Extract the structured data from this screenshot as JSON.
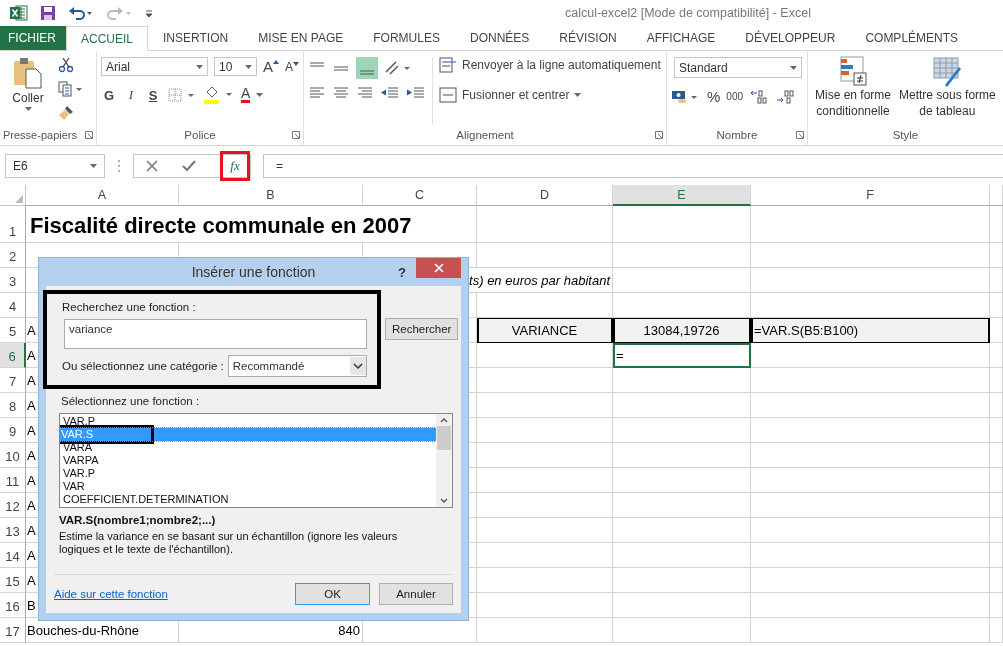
{
  "window": {
    "title": "calcul-excel2  [Mode de compatibilité] - Excel"
  },
  "tabs": [
    {
      "label": "FICHIER",
      "kind": "file",
      "selected": false
    },
    {
      "label": "ACCUEIL",
      "kind": "tab",
      "selected": true
    },
    {
      "label": "INSERTION",
      "kind": "tab",
      "selected": false
    },
    {
      "label": "MISE EN PAGE",
      "kind": "tab",
      "selected": false
    },
    {
      "label": "FORMULES",
      "kind": "tab",
      "selected": false
    },
    {
      "label": "DONNÉES",
      "kind": "tab",
      "selected": false
    },
    {
      "label": "RÉVISION",
      "kind": "tab",
      "selected": false
    },
    {
      "label": "AFFICHAGE",
      "kind": "tab",
      "selected": false
    },
    {
      "label": "DÉVELOPPEUR",
      "kind": "tab",
      "selected": false
    },
    {
      "label": "COMPLÉMENTS",
      "kind": "tab",
      "selected": false
    }
  ],
  "ribbon": {
    "clipboard": {
      "label": "Presse-papiers",
      "paste": "Coller"
    },
    "font": {
      "label": "Police",
      "font_name": "Arial",
      "font_size": "10",
      "grow": "A",
      "shrink": "A",
      "styles": [
        {
          "label": "G",
          "kind": "bold"
        },
        {
          "label": "I",
          "kind": "italic"
        },
        {
          "label": "S",
          "kind": "underline"
        }
      ],
      "font_color": "A"
    },
    "alignment": {
      "label": "Alignement",
      "wrap": "Renvoyer à la ligne automatiquement",
      "merge": "Fusionner et centrer"
    },
    "number": {
      "label": "Nombre",
      "format": "Standard",
      "percent": "%",
      "thousands": "000"
    },
    "style": {
      "label": "Style",
      "buttons": [
        {
          "lines": [
            "Mise en forme",
            "conditionnelle"
          ],
          "kind": "conditional"
        },
        {
          "lines": [
            "Mettre sous forme",
            "de tableau"
          ],
          "kind": "table"
        }
      ]
    }
  },
  "formula_bar": {
    "name_box": "E6",
    "function_button": "fx",
    "function_button_highlighted": true,
    "formula": "="
  },
  "sheet": {
    "columns": [
      {
        "label": "A",
        "selected": false
      },
      {
        "label": "B",
        "selected": false
      },
      {
        "label": "C",
        "selected": false
      },
      {
        "label": "D",
        "selected": false
      },
      {
        "label": "E",
        "selected": true
      },
      {
        "label": "F",
        "selected": false
      }
    ],
    "rows": [
      {
        "number": "1",
        "selected": false,
        "cells": {
          "A": {
            "text": "Fiscalité directe communale en 2007",
            "kind": "title"
          }
        }
      },
      {
        "number": "2",
        "selected": false,
        "cells": {}
      },
      {
        "number": "3",
        "selected": false,
        "cells": {
          "C": {
            "text": "ts) en euros par habitant",
            "kind": "note"
          }
        }
      },
      {
        "number": "4",
        "selected": false,
        "cells": {}
      },
      {
        "number": "5",
        "selected": false,
        "cells": {
          "A": {
            "text": "A",
            "kind": "text"
          },
          "D": {
            "text": "VARIANCE",
            "kind": "boxed-center"
          },
          "E": {
            "text": "13084,19726",
            "kind": "boxed-center"
          },
          "F": {
            "text": "=VAR.S(B5:B100)",
            "kind": "boxed"
          }
        }
      },
      {
        "number": "6",
        "selected": true,
        "cells": {
          "A": {
            "text": "A",
            "kind": "text"
          },
          "E": {
            "text": "=",
            "kind": "active"
          }
        }
      },
      {
        "number": "7",
        "selected": false,
        "cells": {
          "A": {
            "text": "A",
            "kind": "text"
          }
        }
      },
      {
        "number": "8",
        "selected": false,
        "cells": {
          "A": {
            "text": "A",
            "kind": "text"
          }
        }
      },
      {
        "number": "9",
        "selected": false,
        "cells": {
          "A": {
            "text": "A",
            "kind": "text"
          }
        }
      },
      {
        "number": "10",
        "selected": false,
        "cells": {
          "A": {
            "text": "A",
            "kind": "text"
          }
        }
      },
      {
        "number": "11",
        "selected": false,
        "cells": {
          "A": {
            "text": "A",
            "kind": "text"
          }
        }
      },
      {
        "number": "12",
        "selected": false,
        "cells": {
          "A": {
            "text": "A",
            "kind": "text"
          }
        }
      },
      {
        "number": "13",
        "selected": false,
        "cells": {
          "A": {
            "text": "A",
            "kind": "text"
          }
        }
      },
      {
        "number": "14",
        "selected": false,
        "cells": {
          "A": {
            "text": "A",
            "kind": "text"
          }
        }
      },
      {
        "number": "15",
        "selected": false,
        "cells": {
          "A": {
            "text": "A",
            "kind": "text"
          }
        }
      },
      {
        "number": "16",
        "selected": false,
        "cells": {
          "A": {
            "text": "B",
            "kind": "text"
          }
        }
      },
      {
        "number": "17",
        "selected": false,
        "cells": {
          "A": {
            "text": "Bouches-du-Rhône",
            "kind": "text"
          },
          "B": {
            "text": "840",
            "kind": "number"
          }
        }
      }
    ]
  },
  "dialog": {
    "title": "Insérer une fonction",
    "help": "?",
    "search_label": "Recherchez une fonction :",
    "search_value": "variance",
    "search_highlighted": true,
    "search_button": "Rechercher",
    "category_label": "Ou sélectionnez une catégorie :",
    "category": "Recommandé",
    "list_label": "Sélectionnez une fonction :",
    "functions": [
      {
        "name": "VAR.P",
        "selected": false,
        "highlighted": false
      },
      {
        "name": "VAR.S",
        "selected": true,
        "highlighted": true
      },
      {
        "name": "VARA",
        "selected": false,
        "highlighted": false
      },
      {
        "name": "VARPA",
        "selected": false,
        "highlighted": false
      },
      {
        "name": "VAR.P",
        "selected": false,
        "highlighted": false
      },
      {
        "name": "VAR",
        "selected": false,
        "highlighted": false
      },
      {
        "name": "COEFFICIENT.DETERMINATION",
        "selected": false,
        "highlighted": false
      }
    ],
    "signature": "VAR.S(nombre1;nombre2;...)",
    "description": "Estime la variance en se basant sur un échantillon (ignore les valeurs logiques et le texte de l'échantillon).",
    "help_link": "Aide sur cette fonction",
    "ok": "OK",
    "cancel": "Annuler"
  }
}
